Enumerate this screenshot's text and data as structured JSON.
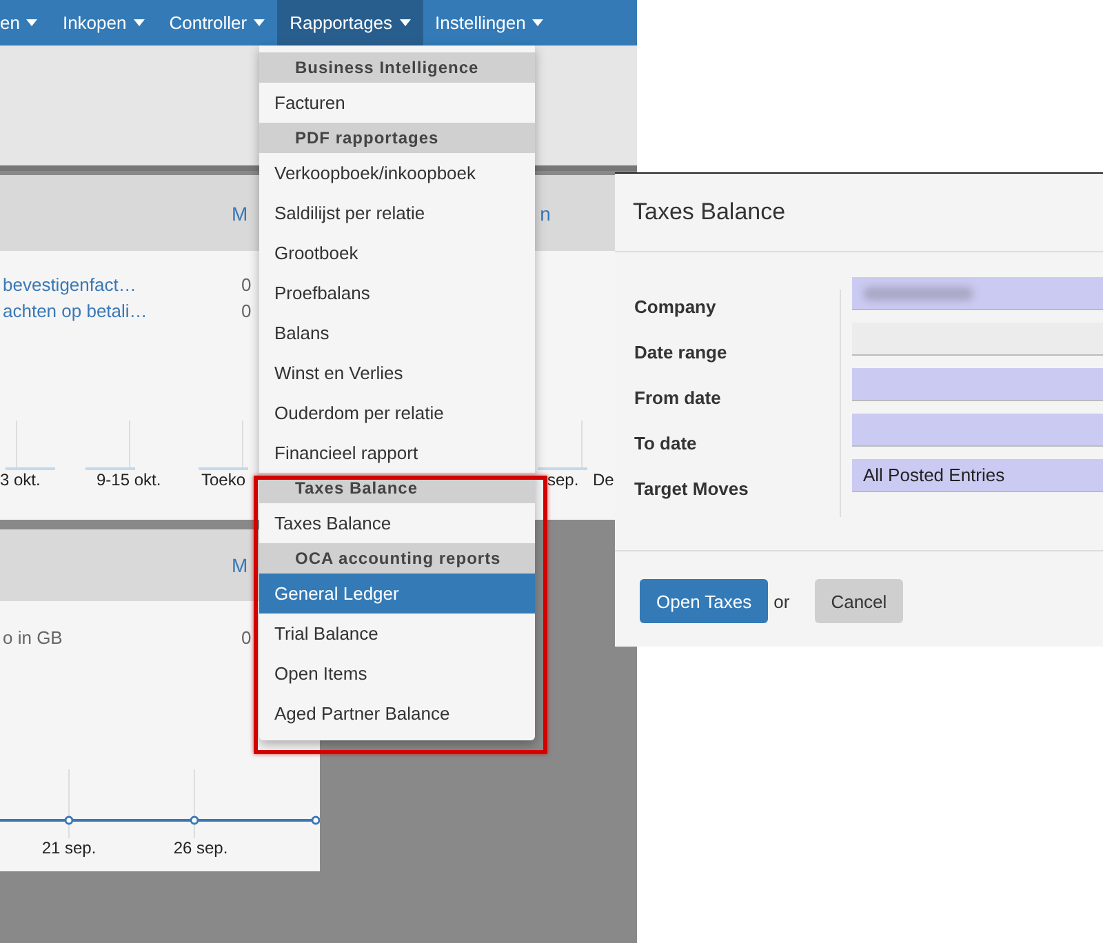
{
  "nav": [
    {
      "label": "en",
      "selected": false
    },
    {
      "label": "Inkopen",
      "selected": false
    },
    {
      "label": "Controller",
      "selected": false
    },
    {
      "label": "Rapportages",
      "selected": true
    },
    {
      "label": "Instellingen",
      "selected": false
    }
  ],
  "cards": [
    {
      "header_links": [
        "M",
        "n"
      ],
      "rows": [
        {
          "kind": "link",
          "label": "bevestigenfact…",
          "value": "0"
        },
        {
          "kind": "link",
          "label": "achten op betali…",
          "value": "0"
        }
      ],
      "axis_labels": [
        "3 okt.",
        "9-15 okt.",
        "Toeko",
        "sep.",
        "De"
      ]
    },
    {
      "header_links": [
        "M"
      ],
      "rows": [
        {
          "kind": "text",
          "label": "o in GB",
          "value": "0"
        }
      ],
      "axis_labels": [
        "21 sep.",
        "26 sep."
      ]
    }
  ],
  "menu": {
    "items": [
      {
        "kind": "header",
        "label": "Business Intelligence"
      },
      {
        "kind": "item",
        "label": "Facturen",
        "selected": false
      },
      {
        "kind": "header",
        "label": "PDF rapportages"
      },
      {
        "kind": "item",
        "label": "Verkoopboek/inkoopboek",
        "selected": false
      },
      {
        "kind": "item",
        "label": "Saldilijst per relatie",
        "selected": false
      },
      {
        "kind": "item",
        "label": "Grootboek",
        "selected": false
      },
      {
        "kind": "item",
        "label": "Proefbalans",
        "selected": false
      },
      {
        "kind": "item",
        "label": "Balans",
        "selected": false
      },
      {
        "kind": "item",
        "label": "Winst en Verlies",
        "selected": false
      },
      {
        "kind": "item",
        "label": "Ouderdom per relatie",
        "selected": false
      },
      {
        "kind": "item",
        "label": "Financieel rapport",
        "selected": false
      },
      {
        "kind": "header",
        "label": "Taxes Balance"
      },
      {
        "kind": "item",
        "label": "Taxes Balance",
        "selected": false
      },
      {
        "kind": "header",
        "label": "OCA accounting reports"
      },
      {
        "kind": "item",
        "label": "General Ledger",
        "selected": true
      },
      {
        "kind": "item",
        "label": "Trial Balance",
        "selected": false
      },
      {
        "kind": "item",
        "label": "Open Items",
        "selected": false
      },
      {
        "kind": "item",
        "label": "Aged Partner Balance",
        "selected": false
      }
    ]
  },
  "dialog": {
    "title": "Taxes Balance",
    "fields": [
      {
        "label": "Company",
        "kind": "redacted"
      },
      {
        "label": "Date range",
        "kind": "plain"
      },
      {
        "label": "From date",
        "kind": "required"
      },
      {
        "label": "To date",
        "kind": "required"
      },
      {
        "label": "Target Moves",
        "kind": "required",
        "value": "All Posted Entries"
      }
    ],
    "buttons": [
      {
        "label": "Open Taxes",
        "kind": "primary"
      },
      {
        "label": "Cancel",
        "kind": "secondary"
      }
    ],
    "separator": "or"
  }
}
